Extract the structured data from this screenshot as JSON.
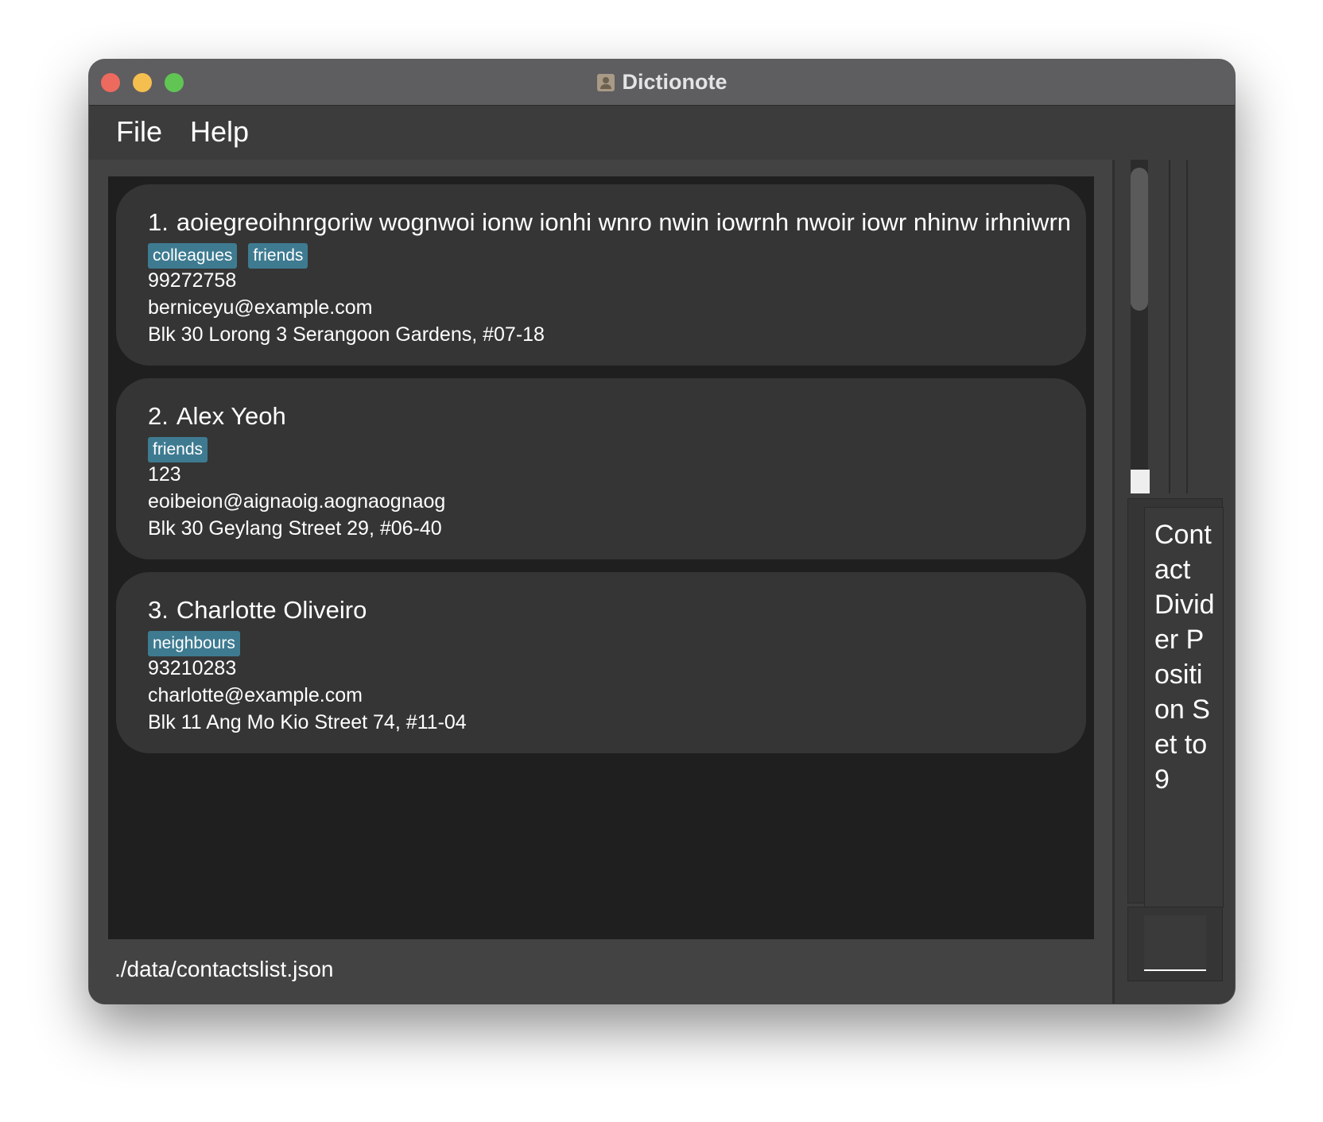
{
  "window": {
    "title": "Dictionote"
  },
  "menu": {
    "file_label": "File",
    "help_label": "Help"
  },
  "contacts": [
    {
      "index": "1.",
      "name": "aoiegreoihnrgoriw wognwoi ionw ionhi wnro nwin iowrnh nwoir iowr nhinw irhniwrn...",
      "tags": [
        "colleagues",
        "friends"
      ],
      "phone": "99272758",
      "email": "berniceyu@example.com",
      "address": "Blk 30 Lorong 3 Serangoon Gardens, #07-18"
    },
    {
      "index": "2.",
      "name": "Alex Yeoh",
      "tags": [
        "friends"
      ],
      "phone": "123",
      "email": "eoibeion@aignaoig.aognaognaog",
      "address": "Blk 30 Geylang Street 29, #06-40"
    },
    {
      "index": "3.",
      "name": "Charlotte Oliveiro",
      "tags": [
        "neighbours"
      ],
      "phone": "93210283",
      "email": "charlotte@example.com",
      "address": "Blk 11 Ang Mo Kio Street 74, #11-04"
    }
  ],
  "status_bar": {
    "file_path": "./data/contactslist.json"
  },
  "result_display": {
    "text": "Contact Divider Position Set to 9"
  },
  "command_box": {
    "value": ""
  },
  "colors": {
    "tag": "#3e7b91",
    "card": "#353535",
    "list_bg": "#1f1f1f",
    "close": "#ed6a5e",
    "minimize": "#f5bf4f",
    "maximize": "#61c554"
  }
}
